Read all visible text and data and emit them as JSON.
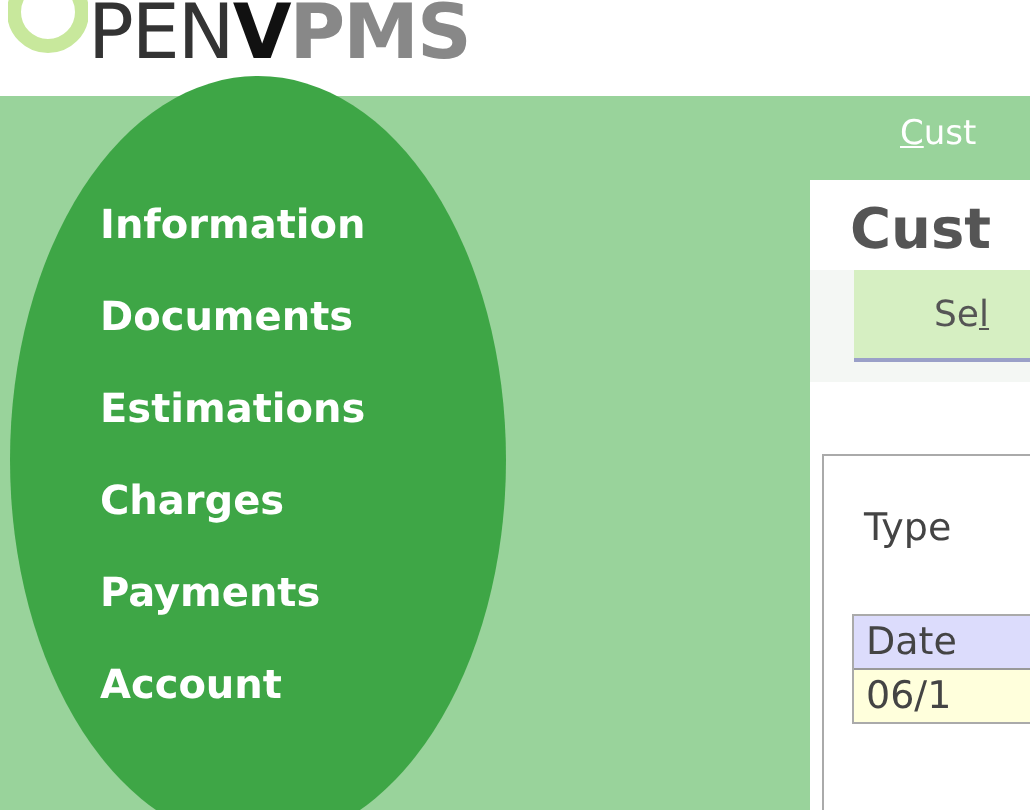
{
  "logo": {
    "parts": [
      {
        "text": "PEN",
        "kind": "dark"
      },
      {
        "text": "V",
        "kind": "black"
      },
      {
        "text": "PMS",
        "kind": "grey"
      }
    ]
  },
  "top_link": {
    "access_key": "C",
    "rest": "ust"
  },
  "sidebar": {
    "items": [
      {
        "label": "Information"
      },
      {
        "label": "Documents"
      },
      {
        "label": "Estimations"
      },
      {
        "label": "Charges"
      },
      {
        "label": "Payments"
      },
      {
        "label": "Account"
      }
    ]
  },
  "content": {
    "title": "Cust",
    "button": {
      "before": "Se",
      "access_key": "l"
    },
    "filter_label": "Type",
    "table": {
      "columns": [
        "Date"
      ],
      "rows": [
        [
          "06/1"
        ]
      ]
    }
  }
}
